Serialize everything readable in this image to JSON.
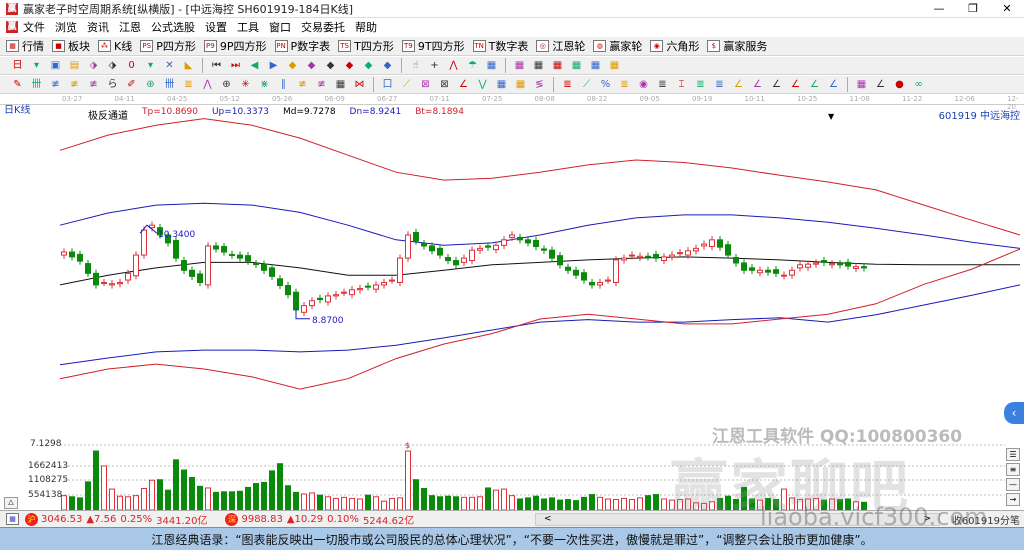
{
  "window": {
    "title": "赢家老子时空周期系统[纵横版] - [中远海控  SH601919-184日K线]",
    "logo": "赢",
    "controls": [
      "—",
      "❐",
      "✕"
    ]
  },
  "menu": [
    "文件",
    "浏览",
    "资讯",
    "江恩",
    "公式选股",
    "设置",
    "工具",
    "窗口",
    "交易委托",
    "帮助"
  ],
  "toolbar1": [
    {
      "label": "行情",
      "icon": "grid-icon",
      "glyph": "▦"
    },
    {
      "label": "板块",
      "icon": "blocks-icon",
      "glyph": "■"
    },
    {
      "label": "K线",
      "icon": "kline-icon",
      "glyph": "⁂"
    },
    {
      "label": "P四方形",
      "icon": "ps-icon",
      "glyph": "PS"
    },
    {
      "label": "9P四方形",
      "icon": "p9-icon",
      "glyph": "P9"
    },
    {
      "label": "P数字表",
      "icon": "pn-icon",
      "glyph": "PN"
    },
    {
      "label": "T四方形",
      "icon": "ts-icon",
      "glyph": "TS"
    },
    {
      "label": "9T四方形",
      "icon": "t9-icon",
      "glyph": "T9"
    },
    {
      "label": "T数字表",
      "icon": "tn-icon",
      "glyph": "TN"
    },
    {
      "label": "江恩轮",
      "icon": "gann-wheel-icon",
      "glyph": "◎"
    },
    {
      "label": "赢家轮",
      "icon": "winner-wheel-icon",
      "glyph": "◍"
    },
    {
      "label": "六角形",
      "icon": "hexagon-icon",
      "glyph": "◉"
    },
    {
      "label": "赢家服务",
      "icon": "dollar-icon",
      "glyph": "$"
    }
  ],
  "toolbar2": [
    "日",
    "▾",
    "▣",
    "▤",
    "⬗",
    "⬗",
    "0",
    "▾",
    "✕",
    "◣",
    "|",
    "⏮",
    "⏭",
    "◀",
    "▶",
    "◆",
    "◆",
    "◆",
    "◆",
    "◆",
    "◆",
    "|",
    "☝",
    "+",
    "⋀",
    "☂",
    "▦",
    "|",
    "▦",
    "▦",
    "▦",
    "▦",
    "▦",
    "▦"
  ],
  "toolbar3": [
    "✎",
    "卌",
    "≢",
    "≢",
    "≢",
    "ら",
    "✐",
    "⊕",
    "卌",
    "≣",
    "⋀",
    "⊕",
    "✳",
    "⋇",
    "∥",
    "≢",
    "≢",
    "▦",
    "⋈",
    "|",
    "口",
    "⟋",
    "⊠",
    "⊠",
    "∠",
    "⋁",
    "▦",
    "▦",
    "≶",
    "|",
    "≣",
    "⟋",
    "%",
    "≣",
    "◉",
    "≣",
    "⌶",
    "≣",
    "≣",
    "∠",
    "∠",
    "∠",
    "∠",
    "∠",
    "∠",
    "|",
    "▦",
    "∠",
    "●",
    "∞"
  ],
  "date_axis": [
    "03-27",
    "04-11",
    "04-25",
    "05-12",
    "05-26",
    "06-09",
    "06-27",
    "07-11",
    "07-25",
    "08-08",
    "08-22",
    "09-05",
    "09-19",
    "10-11",
    "10-25",
    "11-08",
    "11-22",
    "12-06",
    "12-20"
  ],
  "chart_label": "日K线",
  "indicator": {
    "name": "极反通道",
    "tp": "Tp=10.8690",
    "up": "Up=10.3373",
    "md": "Md=9.7278",
    "dn": "Dn=8.9241",
    "bt": "Bt=8.1894"
  },
  "stock": "601919  中远海控",
  "colors": {
    "up": "#e0303a",
    "down": "#0a8a0a",
    "band_outer": "#d0202a",
    "band_inner": "#1a1ab8",
    "mid": "#111111"
  },
  "chart_data": {
    "type": "candlestick",
    "title": "中远海控 SH601919 日K线",
    "ylim": [
      6.65,
      12.1
    ],
    "annotations": {
      "high": "10.3400",
      "low": "8.8700",
      "high_index": 11,
      "low_index": 29,
      "marker": "$",
      "marker_index": 43
    },
    "band_x_fraction_points": 21,
    "bands": {
      "top_red": [
        11.57,
        11.82,
        11.98,
        12.09,
        11.98,
        11.77,
        11.49,
        11.21,
        11.08,
        11.11,
        11.21,
        11.33,
        11.41,
        11.37,
        11.28,
        11.16,
        11.05,
        10.92,
        10.67,
        10.42,
        10.18
      ],
      "upper_blue": [
        10.34,
        10.54,
        10.67,
        10.7,
        10.67,
        10.55,
        10.34,
        10.1,
        10.01,
        10.05,
        10.18,
        10.34,
        10.46,
        10.51,
        10.51,
        10.46,
        10.39,
        10.29,
        10.18,
        10.06,
        9.96
      ],
      "mid": [
        9.36,
        9.52,
        9.64,
        9.73,
        9.73,
        9.64,
        9.52,
        9.52,
        9.6,
        9.69,
        9.73,
        9.77,
        9.8,
        9.82,
        9.8,
        9.77,
        9.73,
        9.7,
        9.69,
        9.69,
        9.69
      ],
      "lower_blue": [
        8.05,
        8.16,
        8.26,
        8.29,
        8.29,
        8.26,
        8.29,
        8.37,
        8.49,
        8.62,
        8.75,
        8.79,
        8.75,
        8.75,
        8.79,
        8.82,
        8.75,
        8.87,
        9.03,
        9.19,
        9.36
      ],
      "bottom_red": [
        7.82,
        7.98,
        8.06,
        7.98,
        7.85,
        7.65,
        7.82,
        8.15,
        8.39,
        8.56,
        8.8,
        8.88,
        8.8,
        8.72,
        8.72,
        8.8,
        8.88,
        9.05,
        9.37,
        9.62,
        9.95
      ]
    },
    "closes": [
      9.9,
      9.82,
      9.75,
      9.55,
      9.36,
      9.4,
      9.38,
      9.4,
      9.55,
      9.85,
      10.26,
      10.34,
      10.18,
      10.05,
      9.8,
      9.6,
      9.5,
      9.4,
      10.0,
      9.95,
      9.9,
      9.85,
      9.8,
      9.75,
      9.7,
      9.6,
      9.5,
      9.35,
      9.2,
      8.95,
      9.02,
      9.1,
      9.12,
      9.18,
      9.2,
      9.24,
      9.28,
      9.3,
      9.33,
      9.36,
      9.4,
      9.44,
      9.8,
      10.18,
      10.08,
      10.0,
      9.92,
      9.85,
      9.76,
      9.69,
      9.8,
      9.93,
      9.96,
      9.98,
      10.01,
      10.1,
      10.18,
      10.1,
      10.05,
      9.99,
      9.93,
      9.8,
      9.69,
      9.6,
      9.52,
      9.44,
      9.36,
      9.4,
      9.44,
      9.77,
      9.8,
      9.85,
      9.83,
      9.82,
      9.8,
      9.82,
      9.85,
      9.89,
      9.92,
      9.96,
      10.03,
      10.1,
      9.98,
      9.85,
      9.72,
      9.6,
      9.6,
      9.6,
      9.57,
      9.55,
      9.52,
      9.6,
      9.69,
      9.7,
      9.72,
      9.73,
      9.71,
      9.69,
      9.67,
      9.66,
      9.64
    ],
    "volume": {
      "ylim": [
        0,
        2250000
      ],
      "ticks": [
        "554138",
        "1108275",
        "1662413"
      ],
      "tick_values": [
        554138,
        1108275,
        1662413
      ],
      "values": [
        520000,
        480000,
        440000,
        1020000,
        2140000,
        1600000,
        760000,
        500000,
        480000,
        520000,
        780000,
        1080000,
        1100000,
        720000,
        1820000,
        1450000,
        1180000,
        860000,
        800000,
        640000,
        660000,
        660000,
        680000,
        820000,
        960000,
        1000000,
        1420000,
        1680000,
        880000,
        640000,
        580000,
        620000,
        540000,
        480000,
        420000,
        460000,
        420000,
        400000,
        540000,
        480000,
        320000,
        420000,
        440000,
        2140000,
        1100000,
        780000,
        520000,
        480000,
        500000,
        480000,
        460000,
        460000,
        480000,
        800000,
        720000,
        760000,
        520000,
        400000,
        440000,
        500000,
        400000,
        440000,
        360000,
        380000,
        340000,
        460000,
        560000,
        460000,
        400000,
        380000,
        420000,
        380000,
        440000,
        520000,
        560000,
        400000,
        360000,
        380000,
        400000,
        260000,
        240000,
        300000,
        420000,
        500000,
        380000,
        820000,
        400000,
        360000,
        420000,
        380000,
        760000,
        440000,
        380000,
        400000,
        420000,
        360000,
        400000,
        380000,
        400000,
        300000,
        280000
      ]
    },
    "secondary_tick": "7.1298"
  },
  "watermark": {
    "line1": "江恩工具软件  QQ:100800360",
    "line2": "赢家聊吧",
    "line3": "liaoba.vicf300.com"
  },
  "status": {
    "sh": {
      "badge": "沪",
      "value": "3046.53",
      "change": "▲7.56",
      "pct": "0.25%",
      "amount": "3441.20亿"
    },
    "sz": {
      "badge": "深",
      "value": "9988.83",
      "change": "▲10.29",
      "pct": "0.10%",
      "amount": "5244.62亿"
    },
    "scroll_left": "<",
    "scroll_right": ">",
    "tick_label": "收601919分笔"
  },
  "quote": "江恩经典语录：“图表能反映出一切股市或公司股民的总体心理状况”，“不要一次性买进，傲慢就是罪过”，“调整只会让股市更加健康”。"
}
